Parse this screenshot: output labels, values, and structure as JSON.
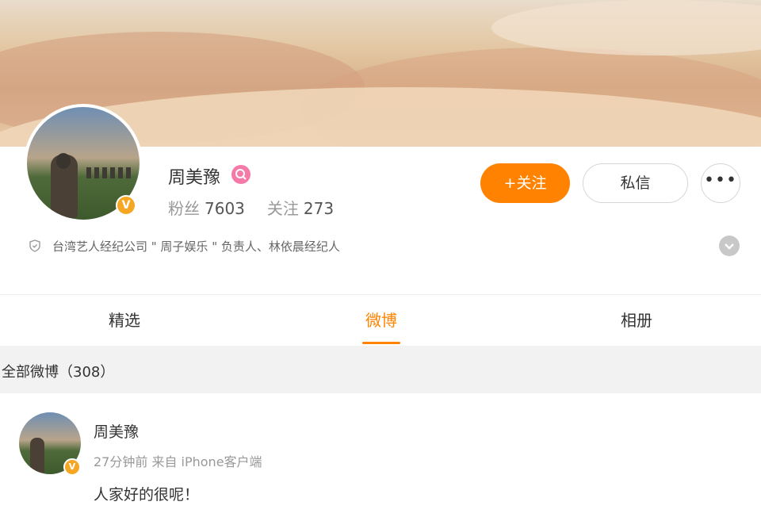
{
  "cover": {
    "description_hidden": ""
  },
  "profile": {
    "name": "周美豫",
    "fans_label": "粉丝",
    "fans_count": "7603",
    "following_label": "关注",
    "following_count": "273",
    "verified_badge": "V",
    "intro": "台湾艺人经纪公司 \" 周子娱乐 \" 负责人、林依晨经纪人",
    "follow_button": "+关注",
    "message_button": "私信",
    "more_button": "•••"
  },
  "tabs": [
    {
      "label": "精选"
    },
    {
      "label": "微博"
    },
    {
      "label": "相册"
    }
  ],
  "section": {
    "title": "全部微博（308）"
  },
  "post": {
    "author": "周美豫",
    "meta": "27分钟前  来自 iPhone客户端",
    "text": "人家好的很呢！"
  },
  "colors": {
    "accent": "#ff8200",
    "verified": "#f5a623",
    "level": "#f57aa8"
  },
  "icons": {
    "intro": "shield-icon",
    "expand": "chevron-down-icon",
    "level": "level-icon"
  }
}
